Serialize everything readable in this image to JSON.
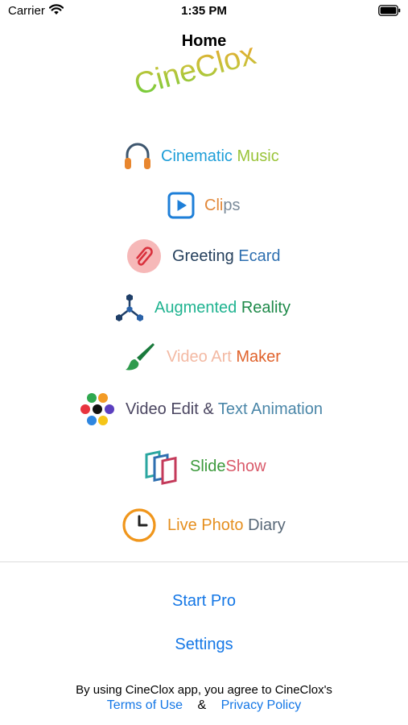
{
  "status_bar": {
    "carrier": "Carrier",
    "time": "1:35 PM",
    "wifi_icon": "wifi-icon",
    "battery_icon": "battery-icon"
  },
  "nav": {
    "title": "Home"
  },
  "logo": {
    "text": "CineClox"
  },
  "menu": [
    {
      "id": "cinematic-music",
      "label_a": "Cinematic",
      "label_b": "Music",
      "icon": "headphones-icon",
      "color_a": "#1e9ed8",
      "color_b": "#9ac43a"
    },
    {
      "id": "clips",
      "label_a": "Cli",
      "label_b": "ps",
      "icon": "play-icon",
      "color_a": "#e2883a",
      "color_b": "#7a8a99"
    },
    {
      "id": "greeting-ecard",
      "label_a": "Greeting",
      "label_b": "Ecard",
      "icon": "paperclip-icon",
      "color_a": "#243f5c",
      "color_b": "#2e6fb0"
    },
    {
      "id": "augmented-reality",
      "label_a": "Augmented",
      "label_b": "Reality",
      "icon": "molecule-icon",
      "color_a": "#1fb390",
      "color_b": "#1f8a4a"
    },
    {
      "id": "video-art-maker",
      "label_a": "Video Art",
      "label_b": "Maker",
      "icon": "paintbrush-icon",
      "color_a": "#f3b9a3",
      "color_b": "#e0622b"
    },
    {
      "id": "video-edit-text-animation",
      "label_a": "Video Edit &",
      "label_b": "Text Animation",
      "icon": "color-dots-icon",
      "color_a": "#4a4560",
      "color_b": "#4a86a8"
    },
    {
      "id": "slideshow",
      "label_a": "Slide",
      "label_b": "Show",
      "icon": "stacked-frames-icon",
      "color_a": "#3c9a3c",
      "color_b": "#d95a6a"
    },
    {
      "id": "live-photo-diary",
      "label_a": "Live Photo",
      "label_b": "Diary",
      "icon": "clock-icon",
      "color_a": "#e58f1f",
      "color_b": "#586878"
    }
  ],
  "actions": {
    "start_pro": "Start Pro",
    "settings": "Settings"
  },
  "footer": {
    "consent_text": "By using CineClox app, you agree to CineClox's",
    "terms_label": "Terms of Use",
    "ampersand": "&",
    "privacy_label": "Privacy Policy"
  },
  "colors": {
    "link_blue": "#1477e6"
  }
}
